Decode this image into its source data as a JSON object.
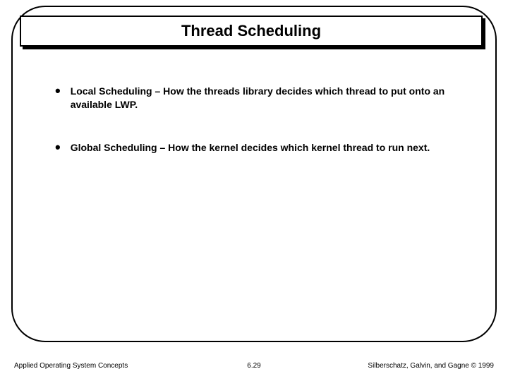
{
  "title": "Thread Scheduling",
  "bullets": [
    {
      "text": "Local Scheduling – How the threads library decides which thread to put onto an available LWP."
    },
    {
      "text": "Global Scheduling – How the kernel decides which kernel thread to run next."
    }
  ],
  "footer": {
    "left": "Applied Operating System Concepts",
    "center": "6.29",
    "right": "Silberschatz, Galvin, and Gagne © 1999"
  }
}
